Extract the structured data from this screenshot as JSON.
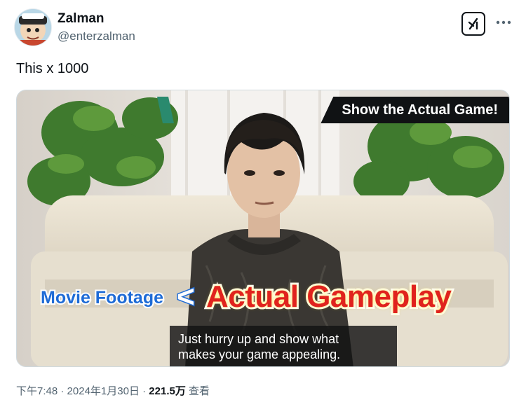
{
  "author": {
    "name": "Zalman",
    "handle": "@enterzalman"
  },
  "tweet": {
    "text": "This x 1000"
  },
  "media": {
    "badge": "Show the Actual Game!",
    "movie_label": "Movie Footage",
    "comparison_symbol": "<",
    "gameplay_label": "Actual Gameplay",
    "subtitle_line1": "Just hurry up and show what",
    "subtitle_line2": "makes your game appealing."
  },
  "meta": {
    "time": "下午7:48",
    "date": "2024年1月30日",
    "separator": "·",
    "views_count": "221.5万",
    "views_label": "查看"
  },
  "icons": {
    "grok": "grok-icon",
    "more": "more-icon"
  },
  "colors": {
    "badge_bg": "#101214",
    "badge_accent": "#2a8a6e",
    "movie_text": "#1e6bd6",
    "gameplay_text": "#e0231e",
    "muted_text": "#536471"
  }
}
